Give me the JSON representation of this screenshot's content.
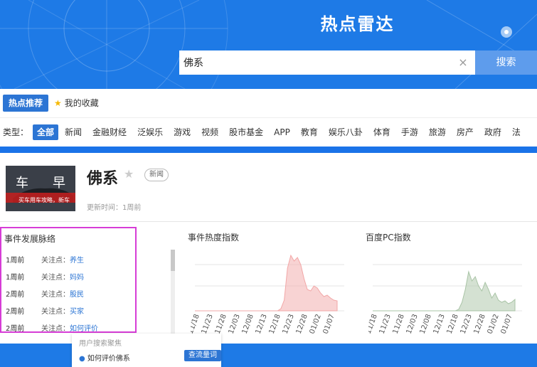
{
  "header": {
    "title": "热点雷达"
  },
  "search": {
    "value": "佛系",
    "clear_icon": "×",
    "button_label": "搜索"
  },
  "tabs": {
    "hot_label": "热点推荐",
    "fav_label": "我的收藏"
  },
  "types": {
    "label": "类型：",
    "items": [
      "全部",
      "新闻",
      "金融财经",
      "泛娱乐",
      "游戏",
      "视频",
      "股市基金",
      "APP",
      "教育",
      "娱乐八卦",
      "体育",
      "手游",
      "旅游",
      "房产",
      "政府",
      "法"
    ],
    "active_index": 0
  },
  "event": {
    "thumb_text_1": "车",
    "thumb_text_2": "早",
    "thumb_caption": "买车用车攻略，新车",
    "title": "佛系",
    "badge": "新闻",
    "update_time": "更新时间：1周前"
  },
  "timeline": {
    "title": "事件发展脉络",
    "rows": [
      {
        "when": "1周前",
        "label": "关注点：",
        "keyword": "养生"
      },
      {
        "when": "1周前",
        "label": "关注点：",
        "keyword": "妈妈"
      },
      {
        "when": "2周前",
        "label": "关注点：",
        "keyword": "股民"
      },
      {
        "when": "2周前",
        "label": "关注点：",
        "keyword": "买家"
      },
      {
        "when": "2周前",
        "label": "关注点：",
        "keyword": "如何评价"
      }
    ]
  },
  "charts": {
    "heat_title": "事件热度指数",
    "baidu_title": "百度PC指数"
  },
  "chart_data": [
    {
      "type": "area",
      "title": "事件热度指数",
      "x_ticks": [
        "11/18",
        "11/23",
        "11/28",
        "12/03",
        "12/08",
        "12/13",
        "12/18",
        "12/23",
        "12/28",
        "01/02",
        "01/07"
      ],
      "y": [
        0,
        0,
        0,
        0,
        0,
        0,
        0,
        0,
        0,
        0,
        0,
        0,
        0,
        0,
        0,
        0,
        0,
        0,
        0,
        0,
        0,
        0,
        0,
        0,
        0,
        0,
        3,
        15,
        60,
        78,
        70,
        75,
        65,
        45,
        30,
        28,
        35,
        32,
        25,
        20,
        22,
        18,
        15,
        14
      ],
      "color": "#f2a7a7"
    },
    {
      "type": "area",
      "title": "百度PC指数",
      "x_ticks": [
        "11/18",
        "11/23",
        "11/28",
        "12/03",
        "12/08",
        "12/13",
        "12/18",
        "12/23",
        "12/28",
        "01/02",
        "01/07"
      ],
      "y": [
        0,
        0,
        0,
        0,
        0,
        0,
        0,
        0,
        0,
        0,
        0,
        0,
        0,
        0,
        0,
        0,
        0,
        0,
        0,
        0,
        0,
        0,
        0,
        0,
        0,
        0,
        2,
        12,
        30,
        55,
        42,
        48,
        35,
        28,
        40,
        30,
        18,
        25,
        15,
        12,
        14,
        10,
        12,
        16
      ],
      "color": "#a9c4a6"
    }
  ],
  "popup": {
    "title": "用户搜索聚焦",
    "item": "如何评价佛系",
    "button": "查流量词"
  }
}
